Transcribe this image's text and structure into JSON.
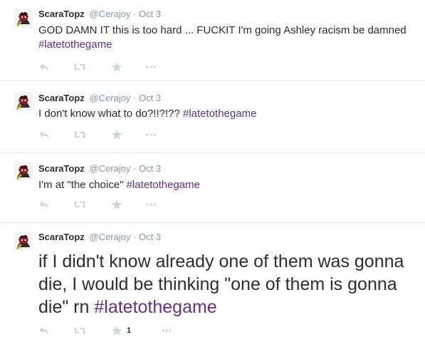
{
  "tweets": [
    {
      "fullname": "ScaraTopz",
      "username": "@Cerajoy",
      "separator": "·",
      "time": "Oct 3",
      "text": "GOD DAMN IT this is too hard ... FUCKIT I'm going Ashley racism be damned ",
      "hashtag": "#latetothegame",
      "favorite_count": ""
    },
    {
      "fullname": "ScaraTopz",
      "username": "@Cerajoy",
      "separator": "·",
      "time": "Oct 3",
      "text": "I don't know what to do?!!?!?? ",
      "hashtag": "#latetothegame",
      "favorite_count": ""
    },
    {
      "fullname": "ScaraTopz",
      "username": "@Cerajoy",
      "separator": "·",
      "time": "Oct 3",
      "text": "I'm at \"the choice\" ",
      "hashtag": "#latetothegame",
      "favorite_count": ""
    },
    {
      "fullname": "ScaraTopz",
      "username": "@Cerajoy",
      "separator": "·",
      "time": "Oct 3",
      "text": "if I didn't know already one of them was gonna die, I would be thinking \"one of them is gonna die\" rn ",
      "hashtag": "#latetothegame",
      "favorite_count": "1"
    }
  ],
  "icons": {
    "reply": "reply-icon",
    "retweet": "retweet-icon",
    "favorite": "star-icon",
    "more": "more-dots-icon"
  },
  "colors": {
    "hashtag": "#66317f",
    "meta": "#8899a6",
    "action_icon": "#ccd6dd",
    "divider": "#e1e8ed"
  }
}
